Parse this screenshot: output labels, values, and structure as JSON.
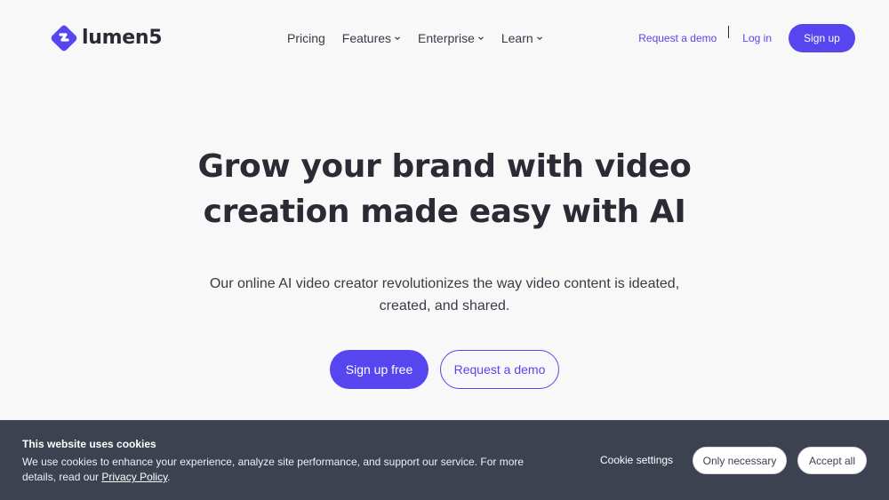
{
  "brand": {
    "name": "lumen5",
    "accent": "#5746f0"
  },
  "nav": {
    "items": [
      {
        "label": "Pricing",
        "dropdown": false
      },
      {
        "label": "Features",
        "dropdown": true
      },
      {
        "label": "Enterprise",
        "dropdown": true
      },
      {
        "label": "Learn",
        "dropdown": true
      }
    ]
  },
  "header_actions": {
    "request_demo": "Request a demo",
    "login": "Log in",
    "signup": "Sign up"
  },
  "hero": {
    "title_line1": "Grow your brand with video",
    "title_line2": "creation made easy with AI",
    "subtitle_line1": "Our online AI video creator revolutionizes the way video content is ideated,",
    "subtitle_line2": "created, and shared.",
    "cta_primary": "Sign up free",
    "cta_secondary": "Request a demo"
  },
  "cookie_banner": {
    "title": "This website uses cookies",
    "text_before": "We use cookies to enhance your experience, analyze site performance, and support our service. For more details, read our ",
    "link": "Privacy Policy",
    "text_after": ".",
    "settings": "Cookie settings",
    "only_necessary": "Only necessary",
    "accept_all": "Accept all",
    "background": "#3d4250"
  },
  "icons": {
    "logo": "lumen5-diamond-logo-icon",
    "dropdown": "chevron-down-icon"
  }
}
